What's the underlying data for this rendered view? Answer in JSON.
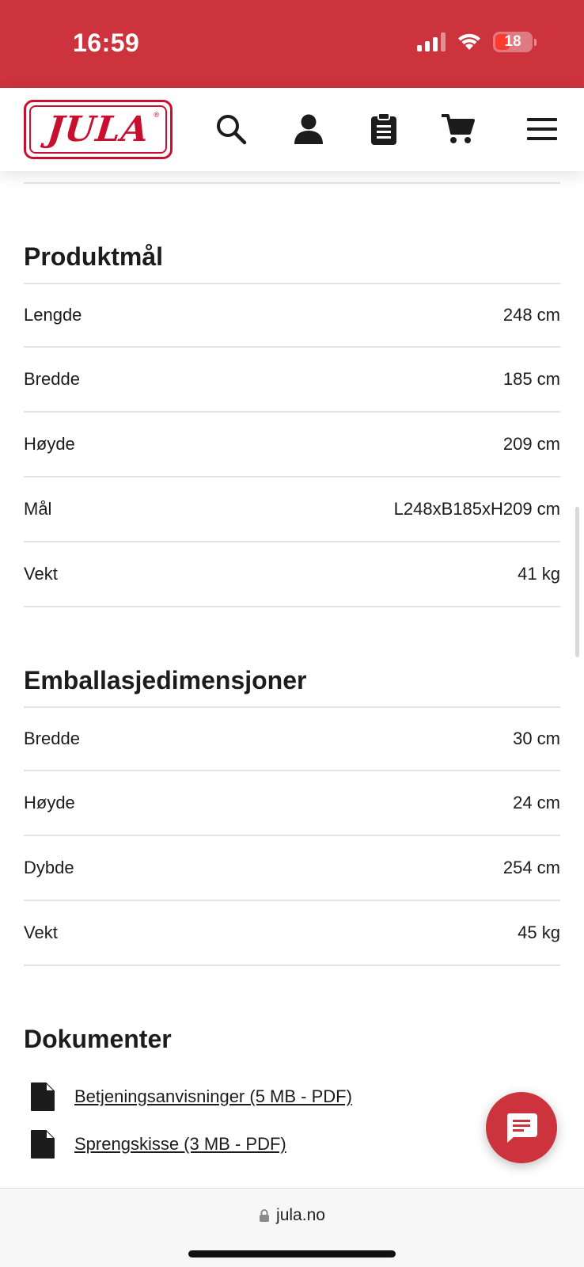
{
  "status_bar": {
    "time": "16:59",
    "battery": "18",
    "colors": {
      "background": "#cc333c",
      "battery_low": "#ff3b30"
    }
  },
  "header": {
    "logo_text": "JULA",
    "logo_mark": "®",
    "icons": [
      "search-icon",
      "user-icon",
      "clipboard-icon",
      "cart-icon",
      "menu-icon"
    ],
    "brand_color": "#c8102e"
  },
  "product_dimensions": {
    "title": "Produktmål",
    "rows": [
      {
        "label": "Lengde",
        "value": "248 cm"
      },
      {
        "label": "Bredde",
        "value": "185 cm"
      },
      {
        "label": "Høyde",
        "value": "209 cm"
      },
      {
        "label": "Mål",
        "value": "L248xB185xH209 cm"
      },
      {
        "label": "Vekt",
        "value": "41 kg"
      }
    ]
  },
  "package_dimensions": {
    "title": "Emballasjedimensjoner",
    "rows": [
      {
        "label": "Bredde",
        "value": "30 cm"
      },
      {
        "label": "Høyde",
        "value": "24 cm"
      },
      {
        "label": "Dybde",
        "value": "254 cm"
      },
      {
        "label": "Vekt",
        "value": "45 kg"
      }
    ]
  },
  "documents": {
    "title": "Dokumenter",
    "links": [
      {
        "label": "Betjeningsanvisninger (5 MB - PDF)"
      },
      {
        "label": "Sprengskisse (3 MB - PDF)"
      }
    ]
  },
  "browser": {
    "url": "jula.no"
  }
}
